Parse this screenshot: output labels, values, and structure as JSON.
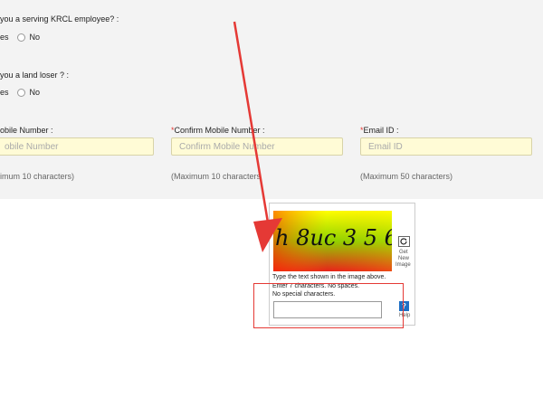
{
  "questions": {
    "employee": {
      "label": "you a serving KRCL employee? :",
      "yes": "es",
      "no": "No"
    },
    "land_loser": {
      "label": "you a land loser ? :",
      "yes": "es",
      "no": "No"
    }
  },
  "fields": {
    "mobile": {
      "label": "obile Number :",
      "placeholder": "obile Number",
      "hint": "imum 10 characters)"
    },
    "confirm_mobile": {
      "required_mark": "*",
      "label": "Confirm Mobile Number :",
      "placeholder": "Confirm Mobile Number",
      "hint": "(Maximum 10 characters"
    },
    "email": {
      "required_mark": "*",
      "label": "Email ID :",
      "placeholder": "Email ID",
      "hint": "(Maximum 50 characters)"
    }
  },
  "captcha": {
    "image_text": "h 8uc 3 5 6",
    "get_new_label_1": "Get",
    "get_new_label_2": "New",
    "get_new_label_3": "Image",
    "instruction_1": "Type the text shown in the image above.",
    "instruction_2": "Enter 7 characters. No spaces.",
    "instruction_3": "No special characters.",
    "help_label": "Help",
    "help_icon_char": "?",
    "input_value": ""
  },
  "colors": {
    "form_bg": "#f3f3f3",
    "input_bg": "#fffbd6",
    "annotation": "#e53935",
    "help_blue": "#1e6fc4"
  }
}
